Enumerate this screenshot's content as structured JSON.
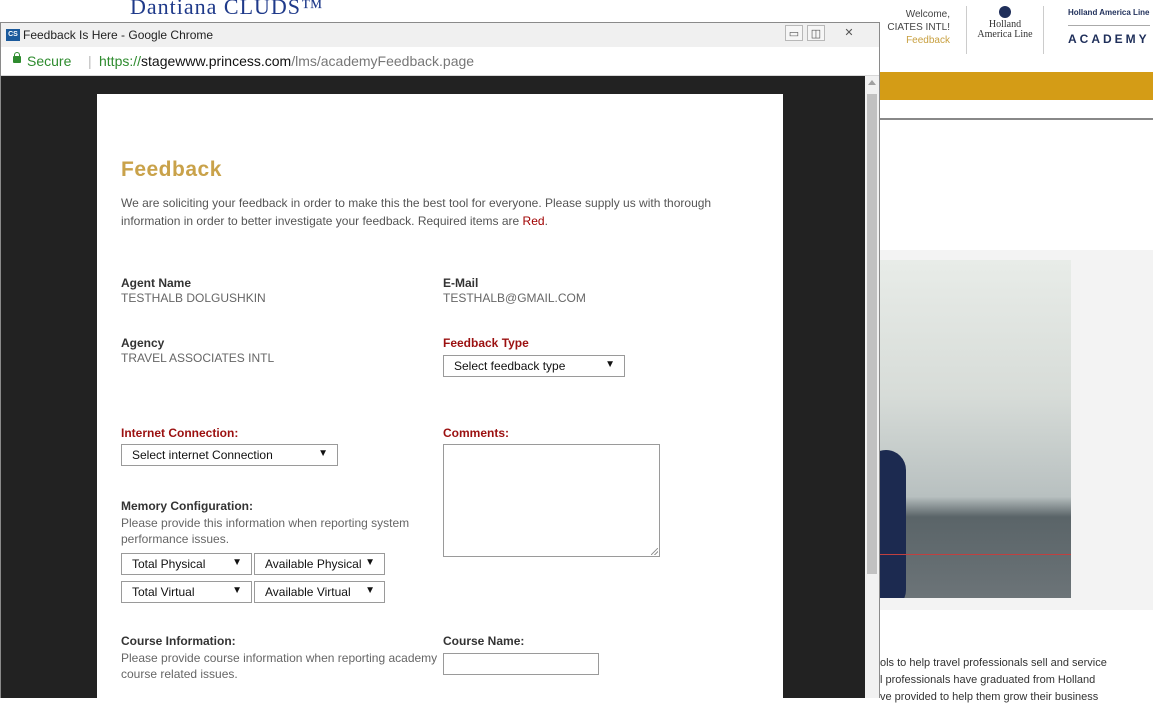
{
  "background_page": {
    "logo_partial": "Dantiana CLUDS™",
    "welcome_lines": [
      "Welcome,",
      "CIATES INTL!"
    ],
    "feedback_link": "Feedback",
    "holland_logo": [
      "Holland",
      "America Line"
    ],
    "academy_small": "Holland America Line",
    "academy_big": "ACADEMY",
    "bottom_text": [
      "ols to help travel professionals sell and service",
      "l professionals have graduated from Holland",
      "ve provided to help them grow their business"
    ]
  },
  "window": {
    "title": "Feedback Is Here - Google Chrome",
    "secure_label": "Secure",
    "url_scheme": "https://",
    "url_host": "stagewww.princess.com",
    "url_path": "/lms/academyFeedback.page",
    "controls": [
      "minimize-icon",
      "restore-icon",
      "close-icon"
    ]
  },
  "form": {
    "title": "Feedback",
    "intro": "We are soliciting your feedback in order to make this the best tool for everyone. Please supply us with thorough information in order to better investigate your feedback. Required items are ",
    "intro_red": "Red",
    "intro_end": ".",
    "agent_name_label": "Agent Name",
    "agent_name_value": "TESTHALB DOLGUSHKIN",
    "email_label": "E-Mail",
    "email_value": "TESTHALB@GMAIL.COM",
    "agency_label": "Agency",
    "agency_value": "TRAVEL ASSOCIATES INTL",
    "feedback_type_label": "Feedback Type",
    "feedback_type_select": "Select feedback type",
    "internet_label": "Internet Connection:",
    "internet_select": "Select internet Connection",
    "comments_label": "Comments:",
    "memory_label": "Memory Configuration:",
    "memory_note": "Please provide this information when reporting system performance issues.",
    "total_physical": "Total Physical",
    "available_physical": "Available Physical",
    "total_virtual": "Total Virtual",
    "available_virtual": "Available Virtual",
    "course_info_label": "Course Information:",
    "course_info_note": "Please provide course information when reporting academy course related issues.",
    "course_name_label": "Course Name:",
    "dropdown_arrow": "▼"
  },
  "colors": {
    "accent_gold": "#c9a24a",
    "required_red": "#9b1010",
    "secure_green": "#2e8b2e"
  }
}
